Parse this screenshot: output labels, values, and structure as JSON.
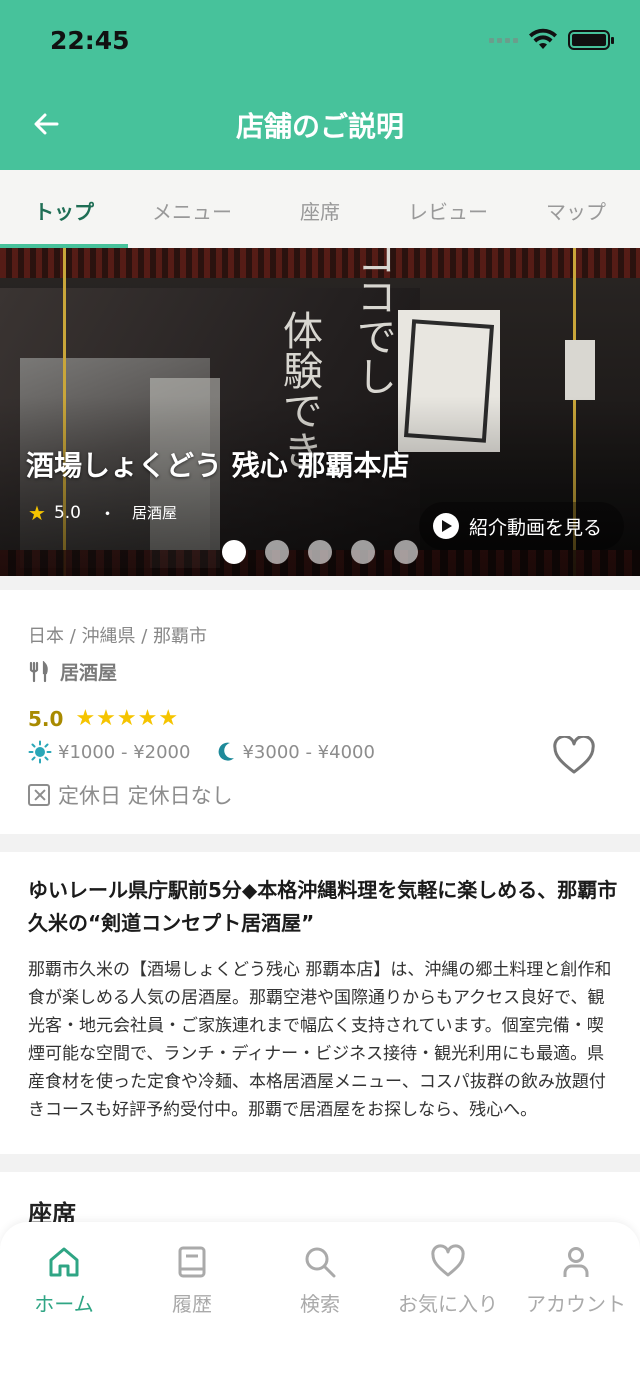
{
  "status_bar": {
    "time": "22:45"
  },
  "header": {
    "title": "店舗のご説明"
  },
  "tabs": [
    {
      "label": "トップ",
      "active": true
    },
    {
      "label": "メニュー",
      "active": false
    },
    {
      "label": "座席",
      "active": false
    },
    {
      "label": "レビュー",
      "active": false
    },
    {
      "label": "マップ",
      "active": false
    }
  ],
  "hero": {
    "shop_name": "酒場しょくどう 残心 那覇本店",
    "rating": "5.0",
    "dot": "・",
    "genre": "居酒屋",
    "video_label": "紹介動画を見る",
    "image_text_1": "ココでし",
    "image_text_2": "体験でき",
    "slide_count": 5,
    "active_slide": 1
  },
  "info": {
    "breadcrumb": "日本 / 沖縄県 / 那覇市",
    "genre": "居酒屋",
    "rating": "5.0",
    "stars": "★★★★★",
    "lunch_price": "¥1000 - ¥2000",
    "dinner_price": "¥3000 - ¥4000",
    "holiday": "定休日 定休日なし"
  },
  "description": {
    "title": "ゆいレール県庁駅前5分◆本格沖縄料理を気軽に楽しめる、那覇市久米の“剣道コンセプト居酒屋”",
    "body": "那覇市久米の【酒場しょくどう残心 那覇本店】は、沖縄の郷土料理と創作和食が楽しめる人気の居酒屋。那覇空港や国際通りからもアクセス良好で、観光客・地元会社員・ご家族連れまで幅広く支持されています。個室完備・喫煙可能な空間で、ランチ・ディナー・ビジネス接待・観光利用にも最適。県産食材を使った定食や冷麺、本格居酒屋メニュー、コスパ抜群の飲み放題付きコースも好評予約受付中。那覇で居酒屋をお探しなら、残心へ。"
  },
  "seats": {
    "title": "座席"
  },
  "bottom_nav": [
    {
      "label": "ホーム",
      "icon": "home-icon",
      "active": true
    },
    {
      "label": "履歴",
      "icon": "history-icon",
      "active": false
    },
    {
      "label": "検索",
      "icon": "search-icon",
      "active": false
    },
    {
      "label": "お気に入り",
      "icon": "heart-icon",
      "active": false
    },
    {
      "label": "アカウント",
      "icon": "account-icon",
      "active": false
    }
  ],
  "colors": {
    "brand": "#47c29b",
    "star": "#f5c400",
    "active_nav": "#2fa584"
  }
}
